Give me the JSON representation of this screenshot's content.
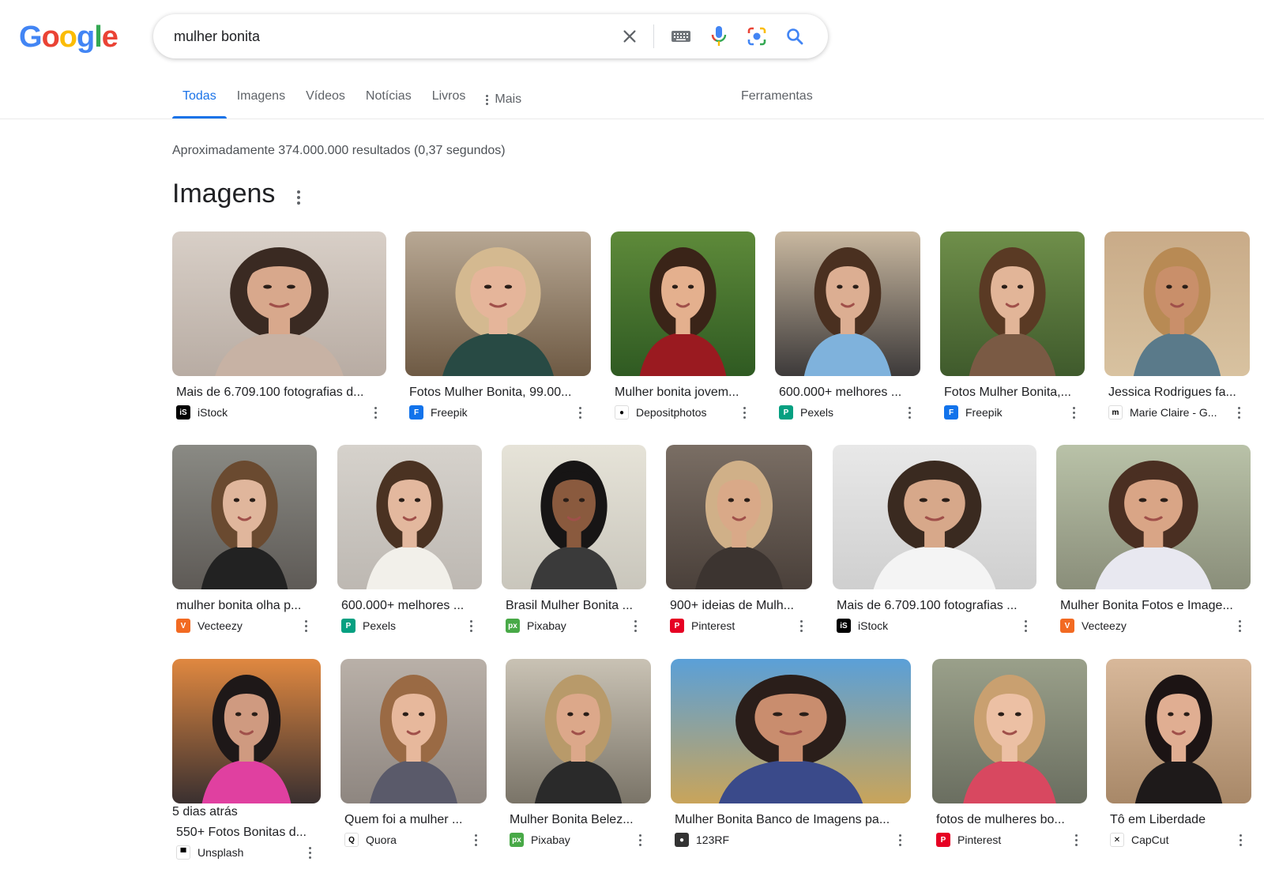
{
  "search": {
    "query": "mulher bonita"
  },
  "tabs": [
    {
      "label": "Todas",
      "active": true
    },
    {
      "label": "Imagens"
    },
    {
      "label": "Vídeos"
    },
    {
      "label": "Notícias"
    },
    {
      "label": "Livros"
    },
    {
      "label": "Mais"
    }
  ],
  "tools_label": "Ferramentas",
  "stats": "Aproximadamente 374.000.000 resultados (0,37 segundos)",
  "section_title": "Imagens",
  "results": [
    {
      "caption": "Mais de 6.709.100 fotografias d...",
      "source": "iStock",
      "favicon": "istock-icon"
    },
    {
      "caption": "Fotos Mulher Bonita, 99.00...",
      "source": "Freepik",
      "favicon": "freepik-icon"
    },
    {
      "caption": "Mulher bonita jovem...",
      "source": "Depositphotos",
      "favicon": "depositphotos-icon"
    },
    {
      "caption": "600.000+ melhores ...",
      "source": "Pexels",
      "favicon": "pexels-icon"
    },
    {
      "caption": "Fotos Mulher Bonita,...",
      "source": "Freepik",
      "favicon": "freepik-icon"
    },
    {
      "caption": "Jessica Rodrigues fa...",
      "source": "Marie Claire - G...",
      "favicon": "marie-claire-icon"
    },
    {
      "caption": "mulher bonita olha p...",
      "source": "Vecteezy",
      "favicon": "vecteezy-icon"
    },
    {
      "caption": "600.000+ melhores ...",
      "source": "Pexels",
      "favicon": "pexels-icon"
    },
    {
      "caption": "Brasil Mulher Bonita ...",
      "source": "Pixabay",
      "favicon": "pixabay-icon"
    },
    {
      "caption": "900+ ideias de Mulh...",
      "source": "Pinterest",
      "favicon": "pinterest-icon"
    },
    {
      "caption": "Mais de 6.709.100 fotografias ...",
      "source": "iStock",
      "favicon": "istock-icon"
    },
    {
      "caption": "Mulher Bonita Fotos e Image...",
      "source": "Vecteezy",
      "favicon": "vecteezy-icon"
    },
    {
      "caption": "550+ Fotos Bonitas d...",
      "source": "Unsplash",
      "favicon": "unsplash-icon",
      "ago": "5 dias atrás"
    },
    {
      "caption": "Quem foi a mulher ...",
      "source": "Quora",
      "favicon": "quora-icon"
    },
    {
      "caption": "Mulher Bonita Belez...",
      "source": "Pixabay",
      "favicon": "pixabay-icon"
    },
    {
      "caption": "Mulher Bonita Banco de Imagens pa...",
      "source": "123RF",
      "favicon": "123rf-icon"
    },
    {
      "caption": "fotos de mulheres bo...",
      "source": "Pinterest",
      "favicon": "pinterest-icon"
    },
    {
      "caption": "Tô em Liberdade",
      "source": "CapCut",
      "favicon": "capcut-icon"
    }
  ],
  "colors": {
    "accent": "#1a73e8",
    "google_blue": "#4285f4",
    "google_red": "#ea4335",
    "google_yellow": "#fbbc05",
    "google_green": "#34a853"
  }
}
